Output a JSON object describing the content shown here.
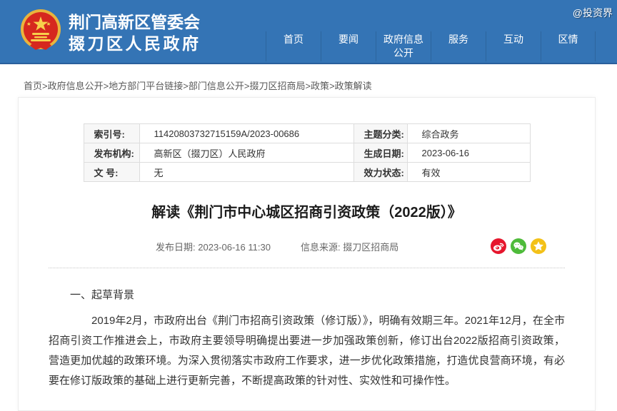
{
  "watermark": "@投资界",
  "header": {
    "site_title_line1": "荆门高新区管委会",
    "site_title_line2": "掇刀区人民政府",
    "nav": [
      {
        "label": "首页"
      },
      {
        "label": "要闻"
      },
      {
        "label": "政府信息公开"
      },
      {
        "label": "服务"
      },
      {
        "label": "互动"
      },
      {
        "label": "区情"
      }
    ],
    "colors": {
      "background": "#3474b5",
      "border_bottom": "#2a5f9c"
    }
  },
  "breadcrumb": {
    "items": [
      "首页",
      "政府信息公开",
      "地方部门平台链接",
      "部门信息公开",
      "掇刀区招商局",
      "政策",
      "政策解读"
    ]
  },
  "meta_table": {
    "rows": [
      {
        "l1": "索引号:",
        "v1": "11420803732715159A/2023-00686",
        "l2": "主题分类:",
        "v2": "综合政务"
      },
      {
        "l1": "发布机构:",
        "v1": "高新区（掇刀区）人民政府",
        "l2": "生成日期:",
        "v2": "2023-06-16"
      },
      {
        "l1": "文 号:",
        "v1": "无",
        "l2": "效力状态:",
        "v2": "有效"
      }
    ]
  },
  "article": {
    "title": "解读《荆门市中心城区招商引资政策（2022版）》",
    "publish_date_label": "发布日期:",
    "publish_date": "2023-06-16 11:30",
    "source_label": "信息来源:",
    "source": "掇刀区招商局",
    "share_icons": [
      {
        "name": "weibo-icon",
        "color": "#e6162d"
      },
      {
        "name": "wechat-icon",
        "color": "#4ebb3a"
      },
      {
        "name": "qzone-star-icon",
        "color": "#f3c118"
      }
    ],
    "section_heading": "一、起草背景",
    "paragraph": "2019年2月，市政府出台《荆门市招商引资政策（修订版）》，明确有效期三年。2021年12月，在全市招商引资工作推进会上，市政府主要领导明确提出要进一步加强政策创新，修订出台2022版招商引资政策，营造更加优越的政策环境。为深入贯彻落实市政府工作要求，进一步优化政策措施，打造优良营商环境，有必要在修订版政策的基础上进行更新完善，不断提高政策的针对性、实效性和可操作性。"
  }
}
